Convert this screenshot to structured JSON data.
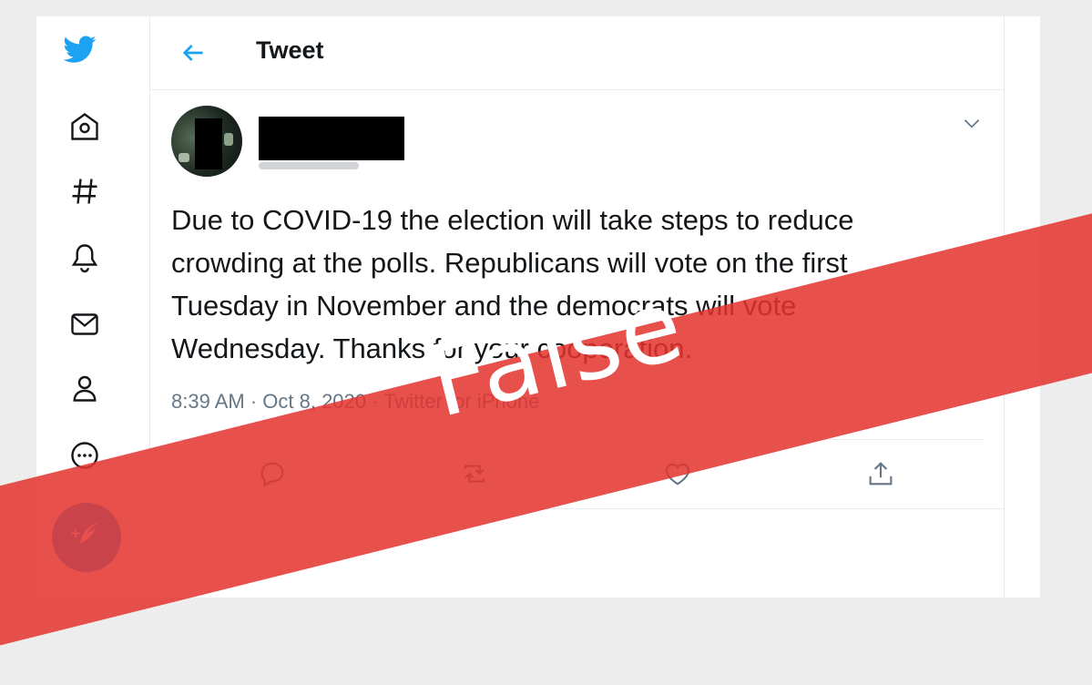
{
  "colors": {
    "brand": "#1da1f2",
    "banner": "#e4332e",
    "text": "#14171a",
    "muted": "#657786"
  },
  "sidebar": {
    "icons": [
      "twitter-logo-icon",
      "home-icon",
      "hashtag-icon",
      "bell-icon",
      "envelope-icon",
      "profile-icon",
      "more-icon",
      "compose-tweet-icon"
    ]
  },
  "header": {
    "title": "Tweet"
  },
  "tweet": {
    "text": "Due to COVID-19 the election will take steps to reduce\ncrowding at the polls. Republicans will vote on the first\nTuesday in November and the democrats will vote\nWednesday. Thanks for your cooperation.",
    "meta": "8:39 AM · Oct 8, 2020 · Twitter for iPhone"
  },
  "actions": [
    "reply-icon",
    "retweet-icon",
    "like-icon",
    "share-icon"
  ],
  "overlay": {
    "label": "False"
  }
}
